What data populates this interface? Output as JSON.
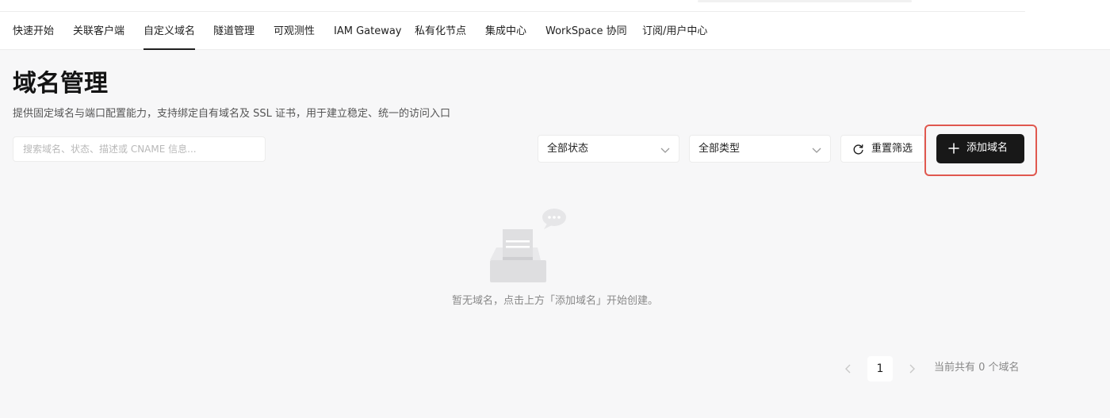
{
  "nav": {
    "items": [
      {
        "label": "快速开始"
      },
      {
        "label": "关联客户端"
      },
      {
        "label": "自定义域名"
      },
      {
        "label": "隧道管理"
      },
      {
        "label": "可观测性"
      },
      {
        "label": "IAM Gateway"
      },
      {
        "label": "私有化节点"
      },
      {
        "label": "集成中心"
      },
      {
        "label": "WorkSpace 协同"
      },
      {
        "label": "订阅/用户中心"
      }
    ],
    "active_label": "自定义域名"
  },
  "page": {
    "title": "域名管理",
    "description": "提供固定域名与端口配置能力，支持绑定自有域名及 SSL 证书，用于建立稳定、统一的访问入口"
  },
  "filters": {
    "search_placeholder": "搜索域名、状态、描述或 CNAME 信息...",
    "status_select": "全部状态",
    "type_select": "全部类型",
    "reset_label": "重置筛选",
    "add_label": "添加域名"
  },
  "empty": {
    "message": "暂无域名，点击上方「添加域名」开始创建。"
  },
  "pagination": {
    "current_page": "1",
    "total_text": "当前共有 0 个域名"
  },
  "icons": {
    "chevron": "chevron-down-icon",
    "reset": "refresh-icon",
    "add": "plus-icon",
    "empty": "empty-inbox-icon",
    "prev": "chevron-left-icon",
    "next": "chevron-right-icon"
  },
  "colors": {
    "primary_button": "#181818",
    "highlight_border": "#e0584f",
    "background": "#f7f7f8"
  }
}
